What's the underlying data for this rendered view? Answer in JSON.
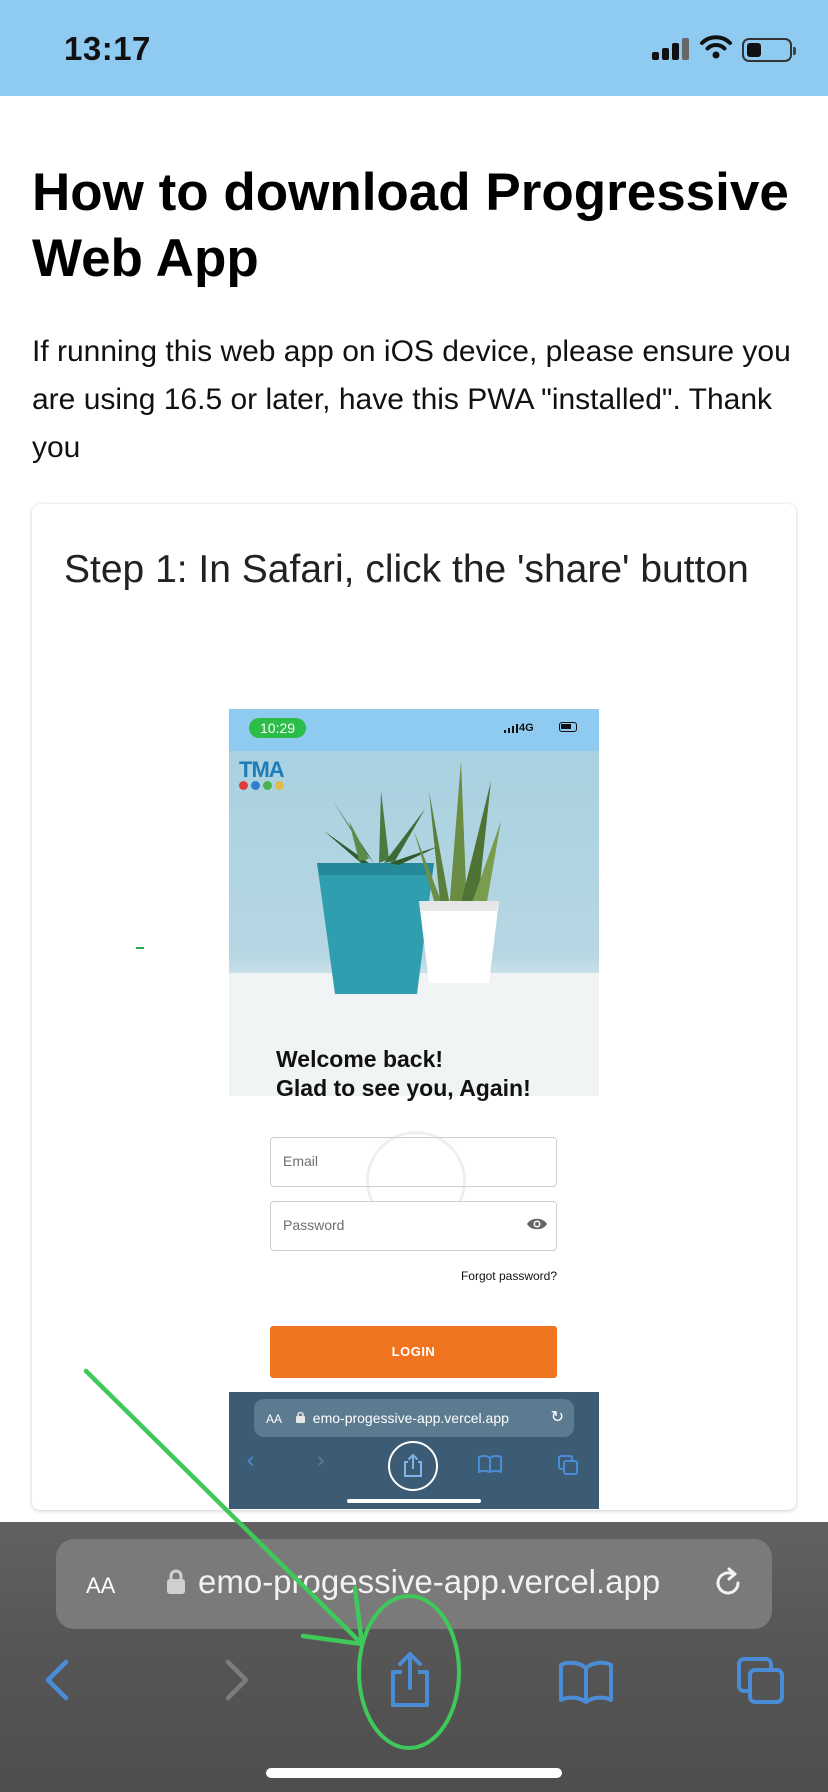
{
  "status_bar": {
    "time": "13:17"
  },
  "page": {
    "title": "How to download Progressive Web App",
    "intro": "If running this web app on iOS device, please ensure you are using 16.5 or later, have this PWA \"installed\". Thank you"
  },
  "step_card": {
    "title": "Step 1: In Safari, click the 'share' button",
    "screenshot": {
      "time": "10:29",
      "network": "4G",
      "logo_text": "TMA",
      "welcome_line1": "Welcome back!",
      "welcome_line2": "Glad to see you, Again!",
      "email_placeholder": "Email",
      "password_placeholder": "Password",
      "forgot_password": "Forgot password?",
      "login_label": "LOGIN",
      "aa_label": "AA",
      "url": "emo-progessive-app.vercel.app",
      "colors": {
        "login": "#f07420",
        "status": "#8fcbf1",
        "time_pill": "#2bbd48"
      }
    }
  },
  "safari": {
    "aa_label": "AA",
    "url": "emo-progessive-app.vercel.app",
    "toolbar": [
      "back-icon",
      "forward-icon",
      "share-icon",
      "bookmarks-icon",
      "tabs-icon"
    ],
    "colors": {
      "accent": "#4a8cd6",
      "annotation": "#3ec95a"
    }
  }
}
